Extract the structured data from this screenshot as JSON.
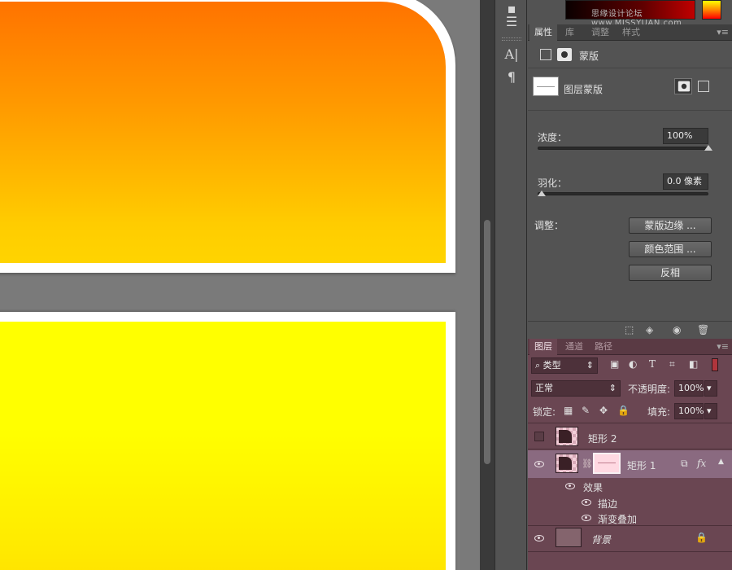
{
  "canvas": {},
  "color_panel": {
    "watermark": "思缘设计论坛 www.MISSYUAN.com"
  },
  "properties_panel": {
    "tabs": [
      "属性",
      "库",
      "调整",
      "样式"
    ],
    "mask_label": "蒙版",
    "layer_mask_label": "图层蒙版",
    "density_label": "浓度：",
    "density_value": "100%",
    "density_fraction": 1.0,
    "feather_label": "羽化：",
    "feather_value": "0.0 像素",
    "feather_fraction": 0.0,
    "adjust_label": "调整：",
    "buttons": [
      "蒙版边缘 ...",
      "颜色范围 ...",
      "反相"
    ]
  },
  "layers_panel": {
    "tabs": [
      "图层",
      "通道",
      "路径"
    ],
    "filter_kind": "类型",
    "filter_icons": [
      "image-filter-icon",
      "adjustment-filter-icon",
      "text-filter-icon",
      "shape-filter-icon",
      "smart-object-filter-icon"
    ],
    "blend_mode": "正常",
    "opacity_label": "不透明度:",
    "opacity_value": "100%",
    "lock_label": "锁定:",
    "fill_label": "填充:",
    "fill_value": "100%",
    "layers": [
      {
        "name": "矩形 2",
        "visible": false
      },
      {
        "name": "矩形 1",
        "visible": true,
        "selected": true,
        "fx": "fx"
      },
      {
        "name": "效果",
        "visible": true
      },
      {
        "name": "描边",
        "visible": true
      },
      {
        "name": "渐变叠加",
        "visible": true
      },
      {
        "name": "背景",
        "visible": true,
        "locked": true
      }
    ]
  },
  "colors": {
    "top_gradient": [
      "#ff7300",
      "#ffd400"
    ],
    "bottom_gradient": [
      "#ffff00",
      "#ffe000"
    ],
    "layer_panel_tint": "#6a4652"
  }
}
